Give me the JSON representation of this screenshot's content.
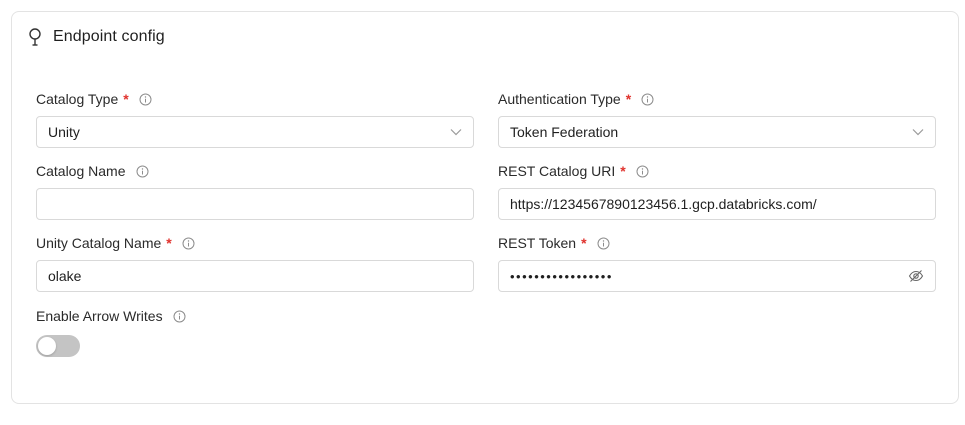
{
  "section": {
    "title": "Endpoint config",
    "icon": "lightbulb-icon"
  },
  "colors": {
    "required": "#e0322d",
    "border": "#d9d9d9",
    "toggle_off": "#c4c4c4"
  },
  "fields": {
    "catalog_type": {
      "label": "Catalog Type",
      "required": "*",
      "value": "Unity"
    },
    "authentication_type": {
      "label": "Authentication Type",
      "required": "*",
      "value": "Token Federation"
    },
    "catalog_name": {
      "label": "Catalog Name",
      "value": ""
    },
    "rest_catalog_uri": {
      "label": "REST Catalog URI",
      "required": "*",
      "value": "https://1234567890123456.1.gcp.databricks.com/"
    },
    "unity_catalog_name": {
      "label": "Unity Catalog Name",
      "required": "*",
      "value": "olake"
    },
    "rest_token": {
      "label": "REST Token",
      "required": "*",
      "masked_value": "•••••••••••••••••"
    },
    "enable_arrow_writes": {
      "label": "Enable Arrow Writes",
      "enabled": false
    }
  }
}
